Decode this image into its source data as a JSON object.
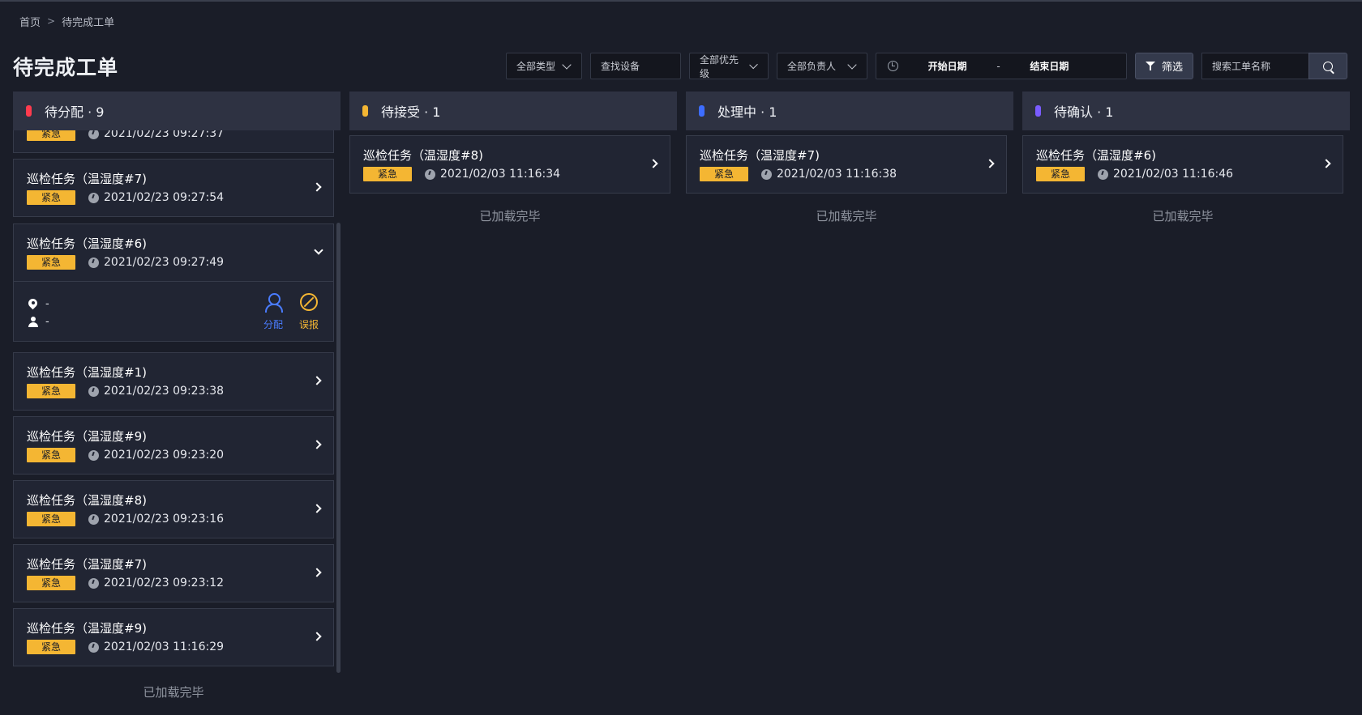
{
  "breadcrumb": {
    "home": "首页",
    "separator": ">",
    "current": "待完成工单"
  },
  "page": {
    "title": "待完成工单"
  },
  "toolbar": {
    "type_select": "全部类型",
    "device_search": "查找设备",
    "priority_select": "全部优先级",
    "owner_select": "全部负责人",
    "start_date": "开始日期",
    "date_sep": "-",
    "end_date": "结束日期",
    "filter_label": "筛选",
    "search_placeholder": "搜索工单名称"
  },
  "colors": {
    "red": "#ff3b4e",
    "yellow": "#f4b633",
    "blue": "#3d6dff",
    "purple": "#7a5cff"
  },
  "columns": [
    {
      "header": "待分配 · 9",
      "cards": [
        {
          "title": "",
          "badge": "紧急",
          "time": "2021/02/23 09:27:37"
        },
        {
          "title": "巡检任务（温湿度#7)",
          "badge": "紧急",
          "time": "2021/02/23 09:27:54"
        },
        {
          "title": "巡检任务（温湿度#6)",
          "badge": "紧急",
          "time": "2021/02/23 09:27:49",
          "location": "-",
          "assignee": "-",
          "assign_label": "分配",
          "report_label": "误报"
        },
        {
          "title": "巡检任务（温湿度#1)",
          "badge": "紧急",
          "time": "2021/02/23 09:23:38"
        },
        {
          "title": "巡检任务（温湿度#9)",
          "badge": "紧急",
          "time": "2021/02/23 09:23:20"
        },
        {
          "title": "巡检任务（温湿度#8)",
          "badge": "紧急",
          "time": "2021/02/23 09:23:16"
        },
        {
          "title": "巡检任务（温湿度#7)",
          "badge": "紧急",
          "time": "2021/02/23 09:23:12"
        },
        {
          "title": "巡检任务（温湿度#9)",
          "badge": "紧急",
          "time": "2021/02/03 11:16:29"
        }
      ],
      "footer": "已加载完毕"
    },
    {
      "header": "待接受 · 1",
      "cards": [
        {
          "title": "巡检任务（温湿度#8)",
          "badge": "紧急",
          "time": "2021/02/03 11:16:34"
        }
      ],
      "footer": "已加载完毕"
    },
    {
      "header": "处理中 · 1",
      "cards": [
        {
          "title": "巡检任务（温湿度#7)",
          "badge": "紧急",
          "time": "2021/02/03 11:16:38"
        }
      ],
      "footer": "已加载完毕"
    },
    {
      "header": "待确认 · 1",
      "cards": [
        {
          "title": "巡检任务（温湿度#6)",
          "badge": "紧急",
          "time": "2021/02/03 11:16:46"
        }
      ],
      "footer": "已加载完毕"
    }
  ]
}
